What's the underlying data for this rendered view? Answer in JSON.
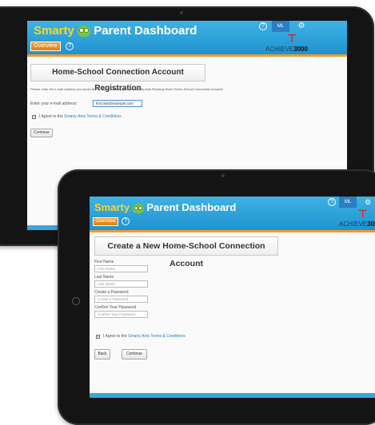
{
  "brand": {
    "smarty": "Smarty",
    "title": "Parent Dashboard",
    "achieve_light": "ACHIEVE",
    "achieve_bold": "3000"
  },
  "nav": {
    "overview": "Overview",
    "help": "?",
    "language": "ML",
    "settings": "⚙"
  },
  "screen1": {
    "heading": "Home-School Connection Account Registration",
    "instruction": "Please enter the e-mail address you would like to use to create your free Smarty Ants Reading World Home-School Connection Account:",
    "email_label": "Enter your e-mail address:",
    "email_value": "first.last@example.com",
    "agree_prefix": "I Agree to the ",
    "agree_link": "Smarty Ants Terms & Conditions",
    "continue": "Continue"
  },
  "screen2": {
    "heading": "Create a New Home-School Connection Account",
    "fields": [
      {
        "label": "First Name",
        "placeholder": "First Name"
      },
      {
        "label": "Last Name",
        "placeholder": "Last Name"
      },
      {
        "label": "Create a Password",
        "placeholder": "Create a Password"
      },
      {
        "label": "Confirm Your Password",
        "placeholder": "Confirm Your Password"
      }
    ],
    "agree_prefix": "I Agree to the ",
    "agree_link": "Smarty Ants Terms & Conditions",
    "back": "Back",
    "continue": "Continue"
  },
  "colors": {
    "header_blue": "#2ba3da",
    "orange": "#f29a2e",
    "brand_yellow": "#ffd51f",
    "accent_red": "#d62828"
  },
  "icons": {
    "owl": "owl-logo-icon",
    "gear": "gear-icon",
    "help": "help-icon",
    "home": "home-button-icon"
  }
}
